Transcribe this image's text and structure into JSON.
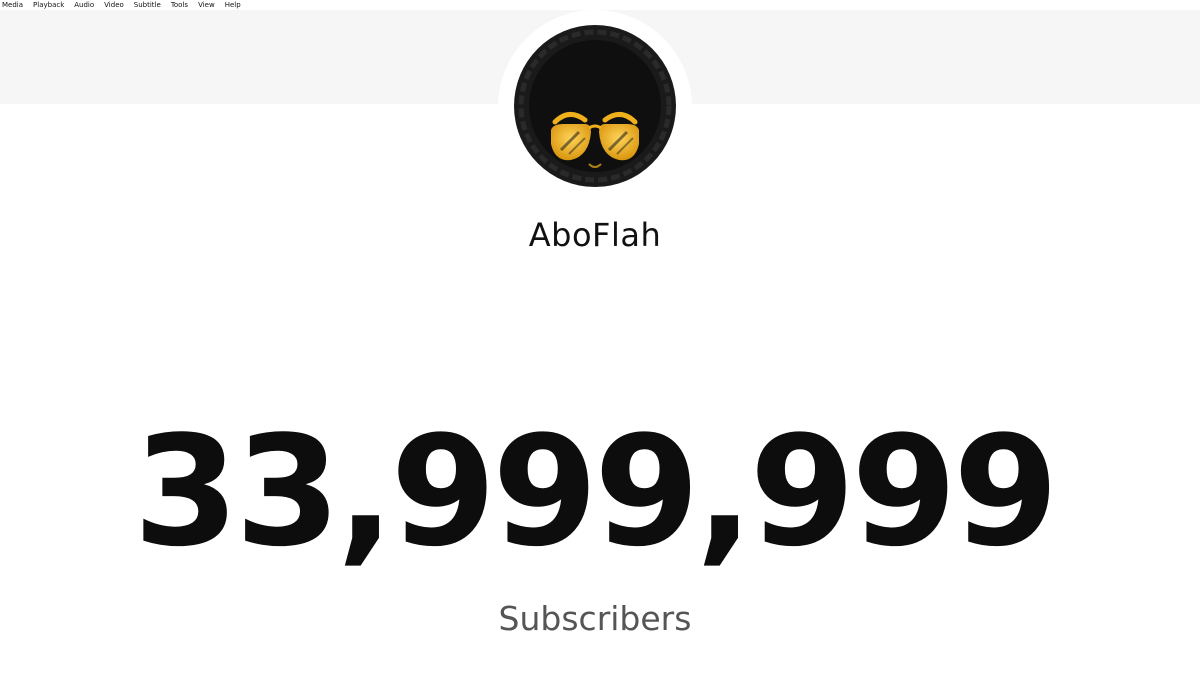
{
  "menubar": {
    "items": [
      {
        "label": "Media"
      },
      {
        "label": "Playback"
      },
      {
        "label": "Audio"
      },
      {
        "label": "Video"
      },
      {
        "label": "Subtitle"
      },
      {
        "label": "Tools"
      },
      {
        "label": "View"
      },
      {
        "label": "Help"
      }
    ]
  },
  "channel": {
    "name": "AboFlah",
    "avatar_icon": "afro-sunglasses-avatar-icon"
  },
  "counter": {
    "value": "33,999,999",
    "label": "Subscribers"
  },
  "colors": {
    "banner": "#f6f6f6",
    "avatar_bg": "#111111",
    "sunglasses_gold": "#f0b01c",
    "count_text": "#0d0d0d",
    "label_text": "#555555"
  }
}
